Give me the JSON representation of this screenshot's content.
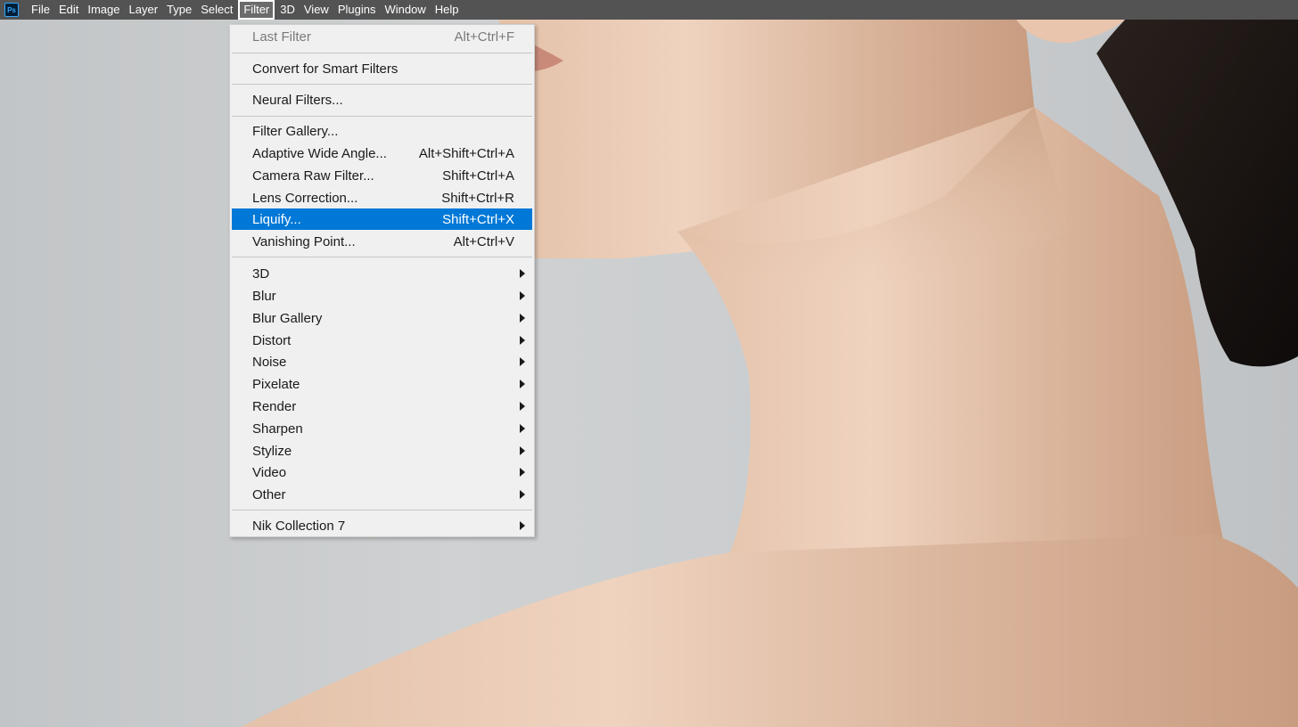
{
  "app": {
    "logo_text": "Ps",
    "accent": "#31a8ff"
  },
  "menubar": {
    "items": [
      "File",
      "Edit",
      "Image",
      "Layer",
      "Type",
      "Select",
      "Filter",
      "3D",
      "View",
      "Plugins",
      "Window",
      "Help"
    ],
    "open_item": "Filter"
  },
  "filter_menu": {
    "last_filter": {
      "label": "Last Filter",
      "shortcut": "Alt+Ctrl+F",
      "enabled": false
    },
    "convert_smart": {
      "label": "Convert for Smart Filters"
    },
    "neural": {
      "label": "Neural Filters..."
    },
    "filter_gallery": {
      "label": "Filter Gallery..."
    },
    "adaptive_wide": {
      "label": "Adaptive Wide Angle...",
      "shortcut": "Alt+Shift+Ctrl+A"
    },
    "camera_raw": {
      "label": "Camera Raw Filter...",
      "shortcut": "Shift+Ctrl+A"
    },
    "lens_correction": {
      "label": "Lens Correction...",
      "shortcut": "Shift+Ctrl+R"
    },
    "liquify": {
      "label": "Liquify...",
      "shortcut": "Shift+Ctrl+X",
      "highlighted": true
    },
    "vanishing_point": {
      "label": "Vanishing Point...",
      "shortcut": "Alt+Ctrl+V"
    },
    "submenus": [
      "3D",
      "Blur",
      "Blur Gallery",
      "Distort",
      "Noise",
      "Pixelate",
      "Render",
      "Sharpen",
      "Stylize",
      "Video",
      "Other"
    ],
    "nik": {
      "label": "Nik Collection 7"
    },
    "highlight_color": "#0078d7"
  }
}
